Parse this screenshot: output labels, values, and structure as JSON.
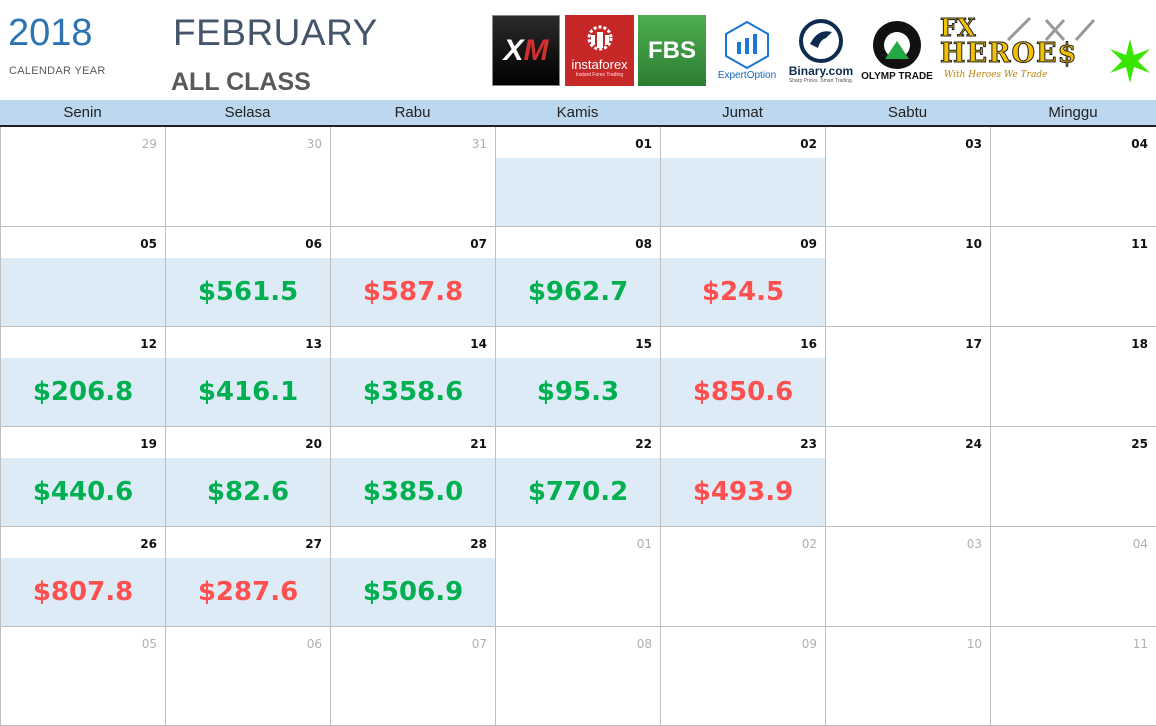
{
  "header": {
    "year": "2018",
    "year_caption": "CALENDAR YEAR",
    "month": "FEBRUARY",
    "class_label": "ALL CLASS"
  },
  "logos": [
    {
      "name": "XM",
      "text_a": "X",
      "text_b": "M"
    },
    {
      "name": "instaforex",
      "text": "instaforex",
      "subtitle": "Instant Forex Trading"
    },
    {
      "name": "FBS",
      "text": "FBS"
    },
    {
      "name": "ExpertOption",
      "text": "ExpertOption"
    },
    {
      "name": "Binary.com",
      "text": "Binary.com",
      "subtitle": "Sharp Prices. Smart Trading."
    },
    {
      "name": "Olymp Trade",
      "text": "OLYMP TRADE"
    },
    {
      "name": "FX Heroes",
      "text_top": "FX",
      "text_main": "HEROE$",
      "tagline": "With Heroes We Trade"
    }
  ],
  "colors": {
    "header_bar": "#bdd7ee",
    "shade": "#ddebf7",
    "positive": "#00b050",
    "negative": "#ff5050",
    "year": "#2e74b5"
  },
  "weekdays": [
    "Senin",
    "Selasa",
    "Rabu",
    "Kamis",
    "Jumat",
    "Sabtu",
    "Minggu"
  ],
  "weeks": [
    [
      {
        "day": "29",
        "other": true,
        "shaded": false,
        "amount": "",
        "sign": ""
      },
      {
        "day": "30",
        "other": true,
        "shaded": false,
        "amount": "",
        "sign": ""
      },
      {
        "day": "31",
        "other": true,
        "shaded": false,
        "amount": "",
        "sign": ""
      },
      {
        "day": "01",
        "other": false,
        "shaded": true,
        "amount": "",
        "sign": ""
      },
      {
        "day": "02",
        "other": false,
        "shaded": true,
        "amount": "",
        "sign": ""
      },
      {
        "day": "03",
        "other": false,
        "shaded": false,
        "amount": "",
        "sign": ""
      },
      {
        "day": "04",
        "other": false,
        "shaded": false,
        "amount": "",
        "sign": ""
      }
    ],
    [
      {
        "day": "05",
        "other": false,
        "shaded": true,
        "amount": "",
        "sign": ""
      },
      {
        "day": "06",
        "other": false,
        "shaded": true,
        "amount": "$561.5",
        "sign": "pos"
      },
      {
        "day": "07",
        "other": false,
        "shaded": true,
        "amount": "$587.8",
        "sign": "neg"
      },
      {
        "day": "08",
        "other": false,
        "shaded": true,
        "amount": "$962.7",
        "sign": "pos"
      },
      {
        "day": "09",
        "other": false,
        "shaded": true,
        "amount": "$24.5",
        "sign": "neg"
      },
      {
        "day": "10",
        "other": false,
        "shaded": false,
        "amount": "",
        "sign": ""
      },
      {
        "day": "11",
        "other": false,
        "shaded": false,
        "amount": "",
        "sign": ""
      }
    ],
    [
      {
        "day": "12",
        "other": false,
        "shaded": true,
        "amount": "$206.8",
        "sign": "pos"
      },
      {
        "day": "13",
        "other": false,
        "shaded": true,
        "amount": "$416.1",
        "sign": "pos"
      },
      {
        "day": "14",
        "other": false,
        "shaded": true,
        "amount": "$358.6",
        "sign": "pos"
      },
      {
        "day": "15",
        "other": false,
        "shaded": true,
        "amount": "$95.3",
        "sign": "pos"
      },
      {
        "day": "16",
        "other": false,
        "shaded": true,
        "amount": "$850.6",
        "sign": "neg"
      },
      {
        "day": "17",
        "other": false,
        "shaded": false,
        "amount": "",
        "sign": ""
      },
      {
        "day": "18",
        "other": false,
        "shaded": false,
        "amount": "",
        "sign": ""
      }
    ],
    [
      {
        "day": "19",
        "other": false,
        "shaded": true,
        "amount": "$440.6",
        "sign": "pos"
      },
      {
        "day": "20",
        "other": false,
        "shaded": true,
        "amount": "$82.6",
        "sign": "pos"
      },
      {
        "day": "21",
        "other": false,
        "shaded": true,
        "amount": "$385.0",
        "sign": "pos"
      },
      {
        "day": "22",
        "other": false,
        "shaded": true,
        "amount": "$770.2",
        "sign": "pos"
      },
      {
        "day": "23",
        "other": false,
        "shaded": true,
        "amount": "$493.9",
        "sign": "neg"
      },
      {
        "day": "24",
        "other": false,
        "shaded": false,
        "amount": "",
        "sign": ""
      },
      {
        "day": "25",
        "other": false,
        "shaded": false,
        "amount": "",
        "sign": ""
      }
    ],
    [
      {
        "day": "26",
        "other": false,
        "shaded": true,
        "amount": "$807.8",
        "sign": "neg"
      },
      {
        "day": "27",
        "other": false,
        "shaded": true,
        "amount": "$287.6",
        "sign": "neg"
      },
      {
        "day": "28",
        "other": false,
        "shaded": true,
        "amount": "$506.9",
        "sign": "pos"
      },
      {
        "day": "01",
        "other": true,
        "shaded": false,
        "amount": "",
        "sign": ""
      },
      {
        "day": "02",
        "other": true,
        "shaded": false,
        "amount": "",
        "sign": ""
      },
      {
        "day": "03",
        "other": true,
        "shaded": false,
        "amount": "",
        "sign": ""
      },
      {
        "day": "04",
        "other": true,
        "shaded": false,
        "amount": "",
        "sign": ""
      }
    ],
    [
      {
        "day": "05",
        "other": true,
        "shaded": false,
        "amount": "",
        "sign": ""
      },
      {
        "day": "06",
        "other": true,
        "shaded": false,
        "amount": "",
        "sign": ""
      },
      {
        "day": "07",
        "other": true,
        "shaded": false,
        "amount": "",
        "sign": ""
      },
      {
        "day": "08",
        "other": true,
        "shaded": false,
        "amount": "",
        "sign": ""
      },
      {
        "day": "09",
        "other": true,
        "shaded": false,
        "amount": "",
        "sign": ""
      },
      {
        "day": "10",
        "other": true,
        "shaded": false,
        "amount": "",
        "sign": ""
      },
      {
        "day": "11",
        "other": true,
        "shaded": false,
        "amount": "",
        "sign": ""
      }
    ]
  ]
}
